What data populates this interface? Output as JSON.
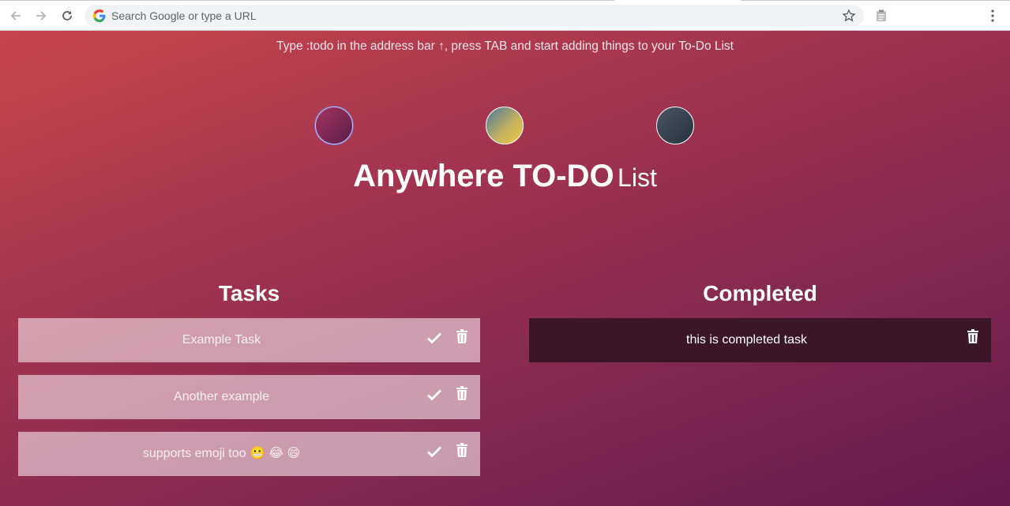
{
  "browser": {
    "omnibox_placeholder": "Search Google or type a URL",
    "icons": [
      "back-icon",
      "forward-icon",
      "reload-icon",
      "google-icon",
      "star-icon",
      "extension-icon",
      "menu-icon"
    ]
  },
  "app": {
    "hint": "Type :todo in the address bar ↑, press TAB and start adding things to your To-Do List",
    "title_main": "Anywhere TO-DO",
    "title_sub": "List",
    "themes": [
      "#a43560",
      "#c9b45a",
      "#29323c"
    ],
    "tasks_heading": "Tasks",
    "completed_heading": "Completed",
    "tasks": [
      {
        "text": "Example Task"
      },
      {
        "text": "Another example"
      },
      {
        "text": "supports emoji too 😬 😂 😄"
      }
    ],
    "completed": [
      {
        "text": "this is completed task"
      }
    ]
  }
}
